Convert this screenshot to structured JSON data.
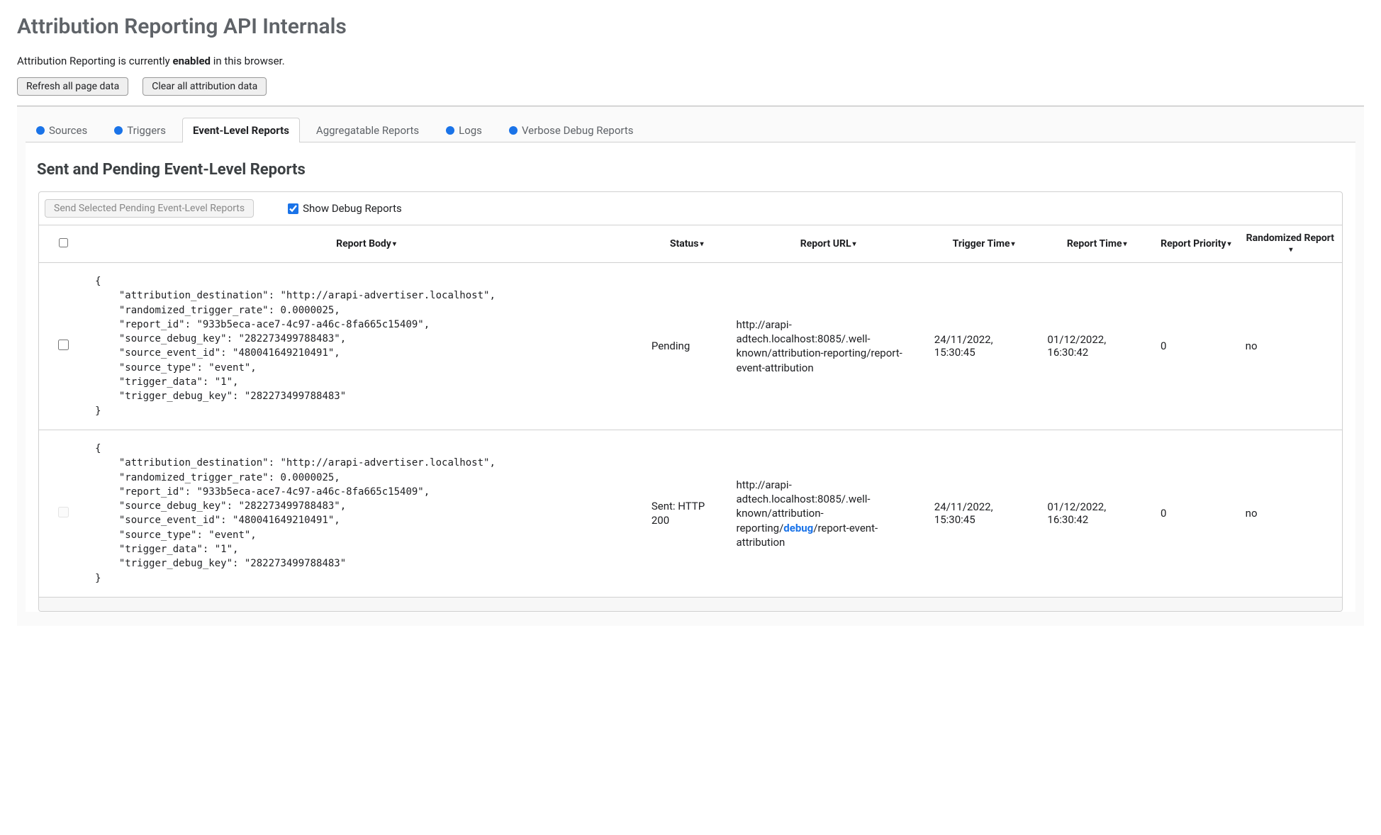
{
  "page_title": "Attribution Reporting API Internals",
  "status": {
    "prefix": "Attribution Reporting is currently ",
    "state": "enabled",
    "suffix": " in this browser."
  },
  "buttons": {
    "refresh": "Refresh all page data",
    "clear": "Clear all attribution data",
    "send_selected": "Send Selected Pending Event-Level Reports"
  },
  "tabs": [
    {
      "label": "Sources",
      "active": false,
      "dot": true
    },
    {
      "label": "Triggers",
      "active": false,
      "dot": true
    },
    {
      "label": "Event-Level Reports",
      "active": true,
      "dot": false
    },
    {
      "label": "Aggregatable Reports",
      "active": false,
      "dot": false
    },
    {
      "label": "Logs",
      "active": false,
      "dot": true
    },
    {
      "label": "Verbose Debug Reports",
      "active": false,
      "dot": true
    }
  ],
  "section_heading": "Sent and Pending Event-Level Reports",
  "show_debug_label": "Show Debug Reports",
  "show_debug_checked": true,
  "columns": {
    "body": "Report Body",
    "status": "Status",
    "url": "Report URL",
    "trigger_time": "Trigger Time",
    "report_time": "Report Time",
    "priority": "Report Priority",
    "randomized": "Randomized Report"
  },
  "rows": [
    {
      "checkbox_disabled": false,
      "body": "{\n    \"attribution_destination\": \"http://arapi-advertiser.localhost\",\n    \"randomized_trigger_rate\": 0.0000025,\n    \"report_id\": \"933b5eca-ace7-4c97-a46c-8fa665c15409\",\n    \"source_debug_key\": \"282273499788483\",\n    \"source_event_id\": \"480041649210491\",\n    \"source_type\": \"event\",\n    \"trigger_data\": \"1\",\n    \"trigger_debug_key\": \"282273499788483\"\n}",
      "status": "Pending",
      "url_before": "http://arapi-adtech.localhost:8085/.well-known/attribution-reporting/report-event-attribution",
      "url_highlight": "",
      "url_after": "",
      "trigger_time": "24/11/2022, 15:30:45",
      "report_time": "01/12/2022, 16:30:42",
      "priority": "0",
      "randomized": "no"
    },
    {
      "checkbox_disabled": true,
      "body": "{\n    \"attribution_destination\": \"http://arapi-advertiser.localhost\",\n    \"randomized_trigger_rate\": 0.0000025,\n    \"report_id\": \"933b5eca-ace7-4c97-a46c-8fa665c15409\",\n    \"source_debug_key\": \"282273499788483\",\n    \"source_event_id\": \"480041649210491\",\n    \"source_type\": \"event\",\n    \"trigger_data\": \"1\",\n    \"trigger_debug_key\": \"282273499788483\"\n}",
      "status": "Sent: HTTP 200",
      "url_before": "http://arapi-adtech.localhost:8085/.well-known/attribution-reporting/",
      "url_highlight": "debug",
      "url_after": "/report-event-attribution",
      "trigger_time": "24/11/2022, 15:30:45",
      "report_time": "01/12/2022, 16:30:42",
      "priority": "0",
      "randomized": "no"
    }
  ]
}
